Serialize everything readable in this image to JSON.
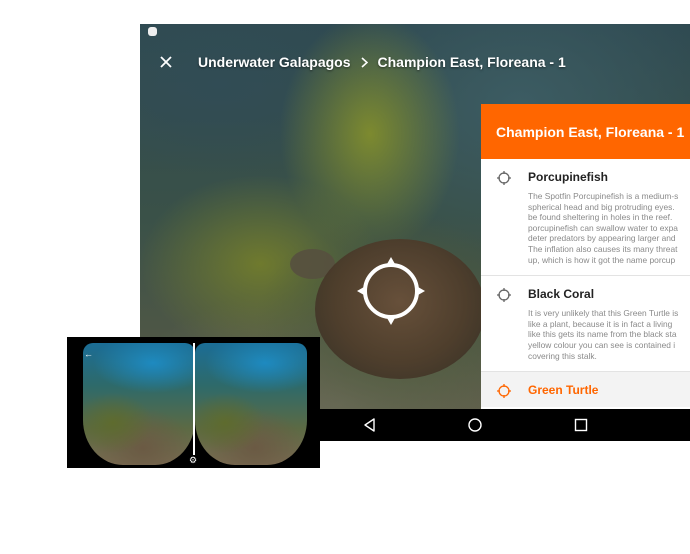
{
  "breadcrumb": {
    "parent": "Underwater Galapagos",
    "current": "Champion East, Floreana - 1"
  },
  "panel": {
    "title": "Champion East, Floreana - 1",
    "items": [
      {
        "title": "Porcupinefish",
        "lines": [
          "The Spotfin Porcupinefish is a medium-s",
          "spherical head and big protruding eyes.",
          "be found sheltering in holes in the reef.",
          "porcupinefish can swallow water to expa",
          "deter predators by appearing larger and",
          "The inflation also causes its many threat",
          "up, which is how it got the name porcup"
        ]
      },
      {
        "title": "Black Coral",
        "lines": [
          "It is very unlikely that this Green Turtle is",
          "like a plant, because it is in fact a living",
          "like this gets its name from the black sta",
          "yellow colour you can see is contained i",
          "covering this stalk."
        ]
      },
      {
        "title": "Green Turtle",
        "lines": []
      }
    ]
  },
  "colors": {
    "accent": "#ff6600",
    "navbar": "#000000"
  },
  "icons": {
    "close": "close-icon",
    "chevron": "chevron-right-icon",
    "hotspot": "crosshair-icon",
    "nav": [
      "back-icon",
      "home-icon",
      "recents-icon"
    ],
    "cardboard": [
      "back-arrow-icon",
      "gear-icon"
    ]
  }
}
